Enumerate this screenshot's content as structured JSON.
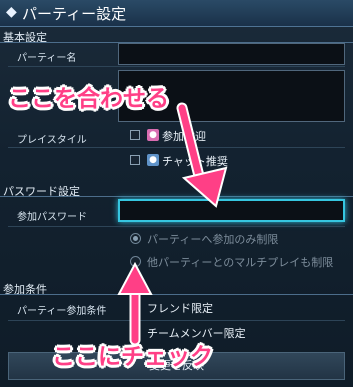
{
  "window": {
    "title": "パーティー設定",
    "title_icon": "diamond-icon"
  },
  "sections": {
    "basic": {
      "heading": "基本設定"
    },
    "password": {
      "heading": "パスワード設定"
    },
    "join": {
      "heading": "参加条件"
    }
  },
  "basic": {
    "party_name": {
      "label": "パーティー名",
      "value": ""
    },
    "comment": {
      "value": ""
    },
    "play_style": {
      "label": "プレイスタイル",
      "options": [
        {
          "label": "参加歓迎",
          "icon": "welcome-icon",
          "checked": false,
          "color": "#d96db1"
        },
        {
          "label": "チャット推奨",
          "icon": "chat-icon",
          "checked": false,
          "color": "#5f93c9"
        }
      ]
    }
  },
  "password": {
    "label": "参加パスワード",
    "value": "",
    "radios": [
      {
        "label": "パーティーへ参加のみ制限",
        "selected": true
      },
      {
        "label": "他パーティーとのマルチプレイも制限",
        "selected": false
      }
    ]
  },
  "join": {
    "label": "パーティー参加条件",
    "options": [
      {
        "label": "フレンド限定",
        "checked": false
      },
      {
        "label": "チームメンバー限定",
        "checked": false
      }
    ]
  },
  "footer": {
    "apply_label": "変更を反映"
  },
  "annotations": {
    "top": "ここを合わせる",
    "bottom": "ここにチェック",
    "color": "#ff3f86"
  }
}
